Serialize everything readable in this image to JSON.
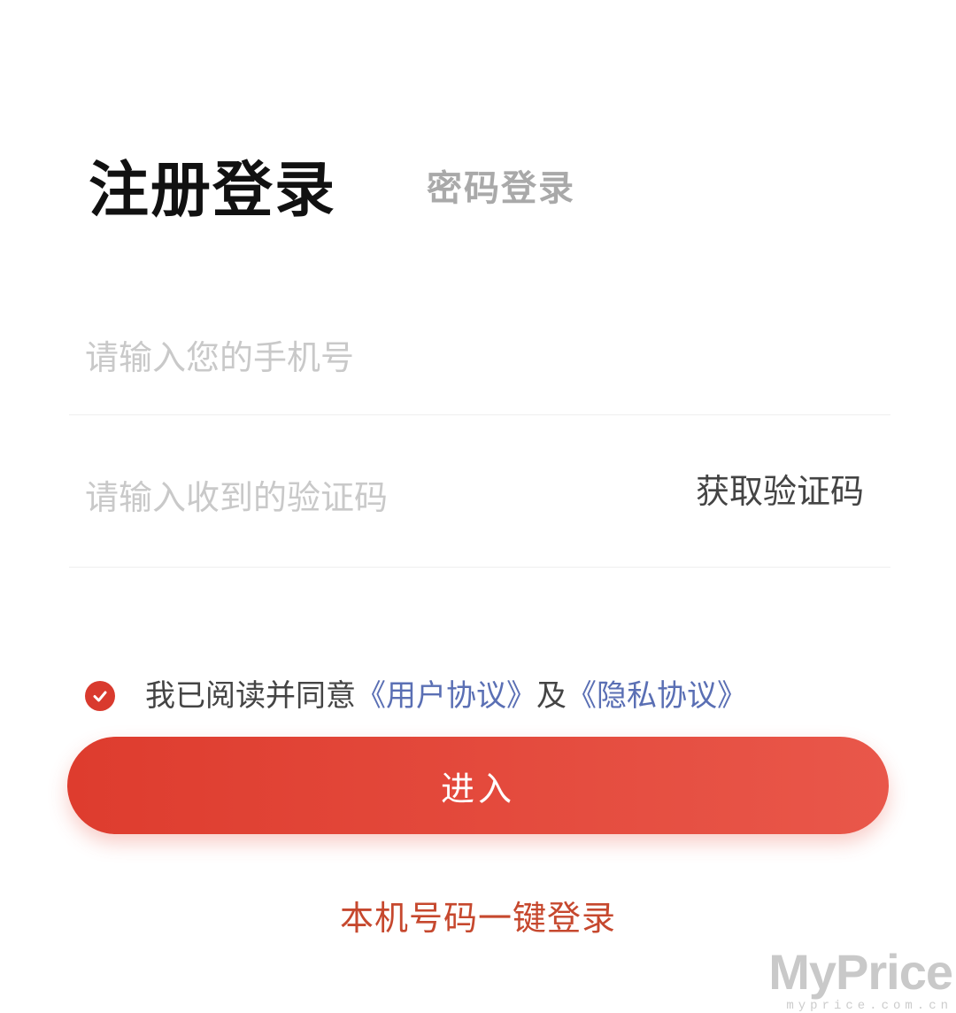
{
  "tabs": {
    "active_label": "注册登录",
    "inactive_label": "密码登录"
  },
  "phone_field": {
    "value": "",
    "placeholder": "请输入您的手机号"
  },
  "code_field": {
    "value": "",
    "placeholder": "请输入收到的验证码",
    "get_code_label": "获取验证码"
  },
  "agreement": {
    "checked": true,
    "prefix": "我已阅读并同意",
    "user_agreement": "《用户协议》",
    "conjunction": "及",
    "privacy_agreement": "《隐私协议》",
    "check_icon": "check-circle-icon"
  },
  "enter_button_label": "进入",
  "one_key_login_label": "本机号码一键登录",
  "watermark": {
    "brand": "MyPrice",
    "url": "myprice.com.cn"
  },
  "colors": {
    "accent": "#de3c2e",
    "link": "#5a6fb4",
    "one_key": "#c6482e"
  }
}
